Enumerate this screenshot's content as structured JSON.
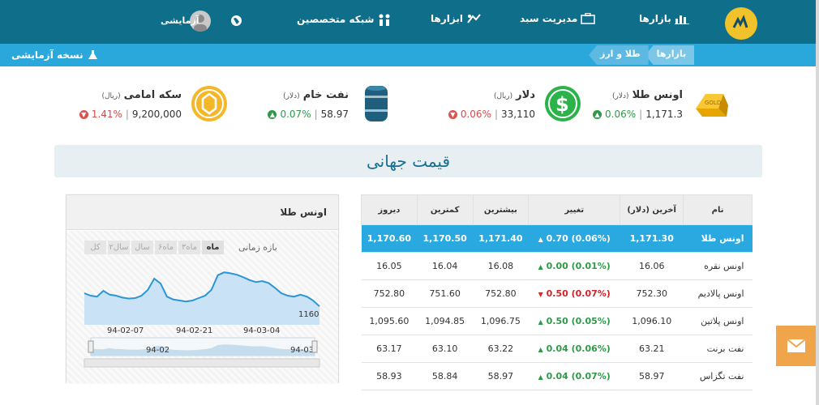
{
  "nav": {
    "markets": "بازارها",
    "portfolio": "مدیریت سبد",
    "tools": "ابزارها",
    "experts": "شبکه متخصصین",
    "user": "آزمایشی"
  },
  "breadcrumb": [
    "بازارها",
    "طلا و ارز"
  ],
  "sample_version": "نسخه آزمایشی",
  "tickers": [
    {
      "name": "اونس طلا",
      "unit": "(دلار)",
      "value": "1,171.3",
      "change": "0.06%",
      "dir": "up"
    },
    {
      "name": "دلار",
      "unit": "(ریال)",
      "value": "33,110",
      "change": "0.06%",
      "dir": "down"
    },
    {
      "name": "نفت خام",
      "unit": "(دلار)",
      "value": "58.97",
      "change": "0.07%",
      "dir": "up"
    },
    {
      "name": "سکه امامی",
      "unit": "(ریال)",
      "value": "9,200,000",
      "change": "1.41%",
      "dir": "down"
    }
  ],
  "global_title": "قیمت جهانی",
  "table": {
    "headers": [
      "نام",
      "آخرین (دلار)",
      "تغییر",
      "بیشترین",
      "کمترین",
      "دیروز"
    ],
    "rows": [
      {
        "name": "اونس طلا",
        "last": "1,171.30",
        "change": "0.70 (0.06%)",
        "dir": "up",
        "high": "1,171.40",
        "low": "1,170.50",
        "prev": "1,170.60",
        "active": true
      },
      {
        "name": "اونس نقره",
        "last": "16.06",
        "change": "0.00 (0.01%)",
        "dir": "up",
        "high": "16.08",
        "low": "16.04",
        "prev": "16.05"
      },
      {
        "name": "اونس پالادیم",
        "last": "752.30",
        "change": "0.50 (0.07%)",
        "dir": "down",
        "high": "752.80",
        "low": "751.60",
        "prev": "752.80"
      },
      {
        "name": "اونس پلاتین",
        "last": "1,096.10",
        "change": "0.50 (0.05%)",
        "dir": "up",
        "high": "1,096.75",
        "low": "1,094.85",
        "prev": "1,095.60"
      },
      {
        "name": "نفت برنت",
        "last": "63.21",
        "change": "0.04 (0.06%)",
        "dir": "up",
        "high": "63.22",
        "low": "63.10",
        "prev": "63.17"
      },
      {
        "name": "نفت تگزاس",
        "last": "58.97",
        "change": "0.04 (0.07%)",
        "dir": "up",
        "high": "58.97",
        "low": "58.84",
        "prev": "58.93"
      }
    ]
  },
  "chart_panel": {
    "title": "اونس طلا",
    "range_label": "بازه زمانی",
    "ranges": [
      "کل",
      "۲سال",
      "سال",
      "۶ماه",
      "۳ماه",
      "ماه"
    ],
    "selected_range": "ماه",
    "last_label": "1160"
  },
  "chart_data": {
    "type": "area",
    "x_ticks": [
      "94-02-07",
      "94-02-21",
      "94-03-04"
    ],
    "nav_ticks": [
      "94-02",
      "94-03"
    ],
    "values": [
      0.55,
      0.5,
      0.48,
      0.6,
      0.52,
      0.5,
      0.46,
      0.44,
      0.45,
      0.5,
      0.62,
      0.85,
      0.75,
      0.48,
      0.42,
      0.4,
      0.38,
      0.4,
      0.45,
      0.5,
      0.62,
      0.92,
      0.98,
      0.96,
      0.93,
      0.88,
      0.82,
      0.78,
      0.8,
      0.76,
      0.66,
      0.55,
      0.5,
      0.48,
      0.52,
      0.48,
      0.4,
      0.28
    ]
  },
  "colors": {
    "accent": "#0f6f8a",
    "subbar": "#2aa8dc",
    "active_row": "#29a9e0",
    "up": "#2e9a48",
    "down": "#d44a4a"
  }
}
